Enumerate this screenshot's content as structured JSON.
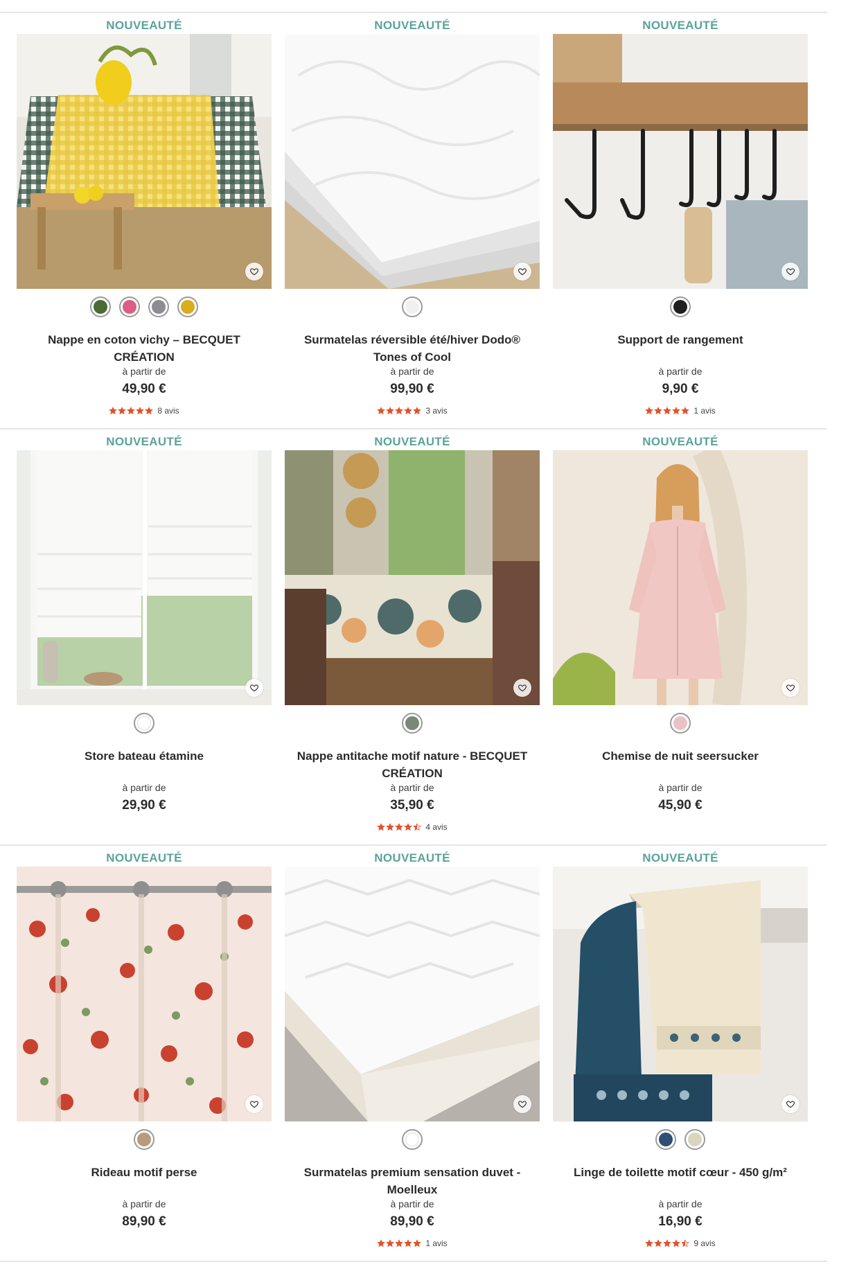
{
  "colors": {
    "tag": "#5aa39a",
    "star": "#e3512b",
    "divider": "#e6e6e6"
  },
  "products": [
    {
      "tag": "NOUVEAUTÉ",
      "name": "Nappe en coton vichy – BECQUET CRÉATION",
      "from_label": "à partir de",
      "price": "49,90 €",
      "swatches": [
        "#4d6b34",
        "#db5e86",
        "#8c8c91",
        "#d8ad1e"
      ],
      "rating": 5,
      "reviews": "8 avis",
      "image": "tablecloth-gingham"
    },
    {
      "tag": "NOUVEAUTÉ",
      "name": "Surmatelas réversible été/hiver Dodo® Tones of Cool",
      "from_label": "à partir de",
      "price": "99,90 €",
      "swatches": [
        "#f0f0f0"
      ],
      "rating": 5,
      "reviews": "3 avis",
      "image": "mattress-topper"
    },
    {
      "tag": "NOUVEAUTÉ",
      "name": "Support de rangement",
      "from_label": "à partir de",
      "price": "9,90 €",
      "swatches": [
        "#1f1f1f"
      ],
      "rating": 5,
      "reviews": "1 avis",
      "image": "hook-rack"
    },
    {
      "tag": "NOUVEAUTÉ",
      "name": "Store bateau étamine",
      "from_label": "à partir de",
      "price": "29,90 €",
      "swatches": [
        "#ffffff"
      ],
      "rating": 0,
      "reviews": "",
      "image": "roman-blind"
    },
    {
      "tag": "NOUVEAUTÉ",
      "name": "Nappe antitache motif nature - BECQUET CRÉATION",
      "from_label": "à partir de",
      "price": "35,90 €",
      "swatches": [
        "#7a8878"
      ],
      "rating": 4.5,
      "reviews": "4 avis",
      "image": "floral-tablecloth"
    },
    {
      "tag": "NOUVEAUTÉ",
      "name": "Chemise de nuit seersucker",
      "from_label": "à partir de",
      "price": "45,90 €",
      "swatches": [
        "#e8c2c4"
      ],
      "rating": 0,
      "reviews": "",
      "image": "nightshirt"
    },
    {
      "tag": "NOUVEAUTÉ",
      "name": "Rideau motif perse",
      "from_label": "à partir de",
      "price": "89,90 €",
      "swatches": [
        "#b99a7a"
      ],
      "rating": 0,
      "reviews": "",
      "image": "floral-curtain"
    },
    {
      "tag": "NOUVEAUTÉ",
      "name": "Surmatelas premium sensation duvet - Moelleux",
      "from_label": "à partir de",
      "price": "89,90 €",
      "swatches": [
        "#ffffff"
      ],
      "rating": 5,
      "reviews": "1 avis",
      "image": "mattress-premium"
    },
    {
      "tag": "NOUVEAUTÉ",
      "name": "Linge de toilette motif cœur - 450 g/m²",
      "from_label": "à partir de",
      "price": "16,90 €",
      "swatches": [
        "#2f4f73",
        "#d9d6bf"
      ],
      "rating": 4.5,
      "reviews": "9 avis",
      "image": "towels"
    }
  ]
}
